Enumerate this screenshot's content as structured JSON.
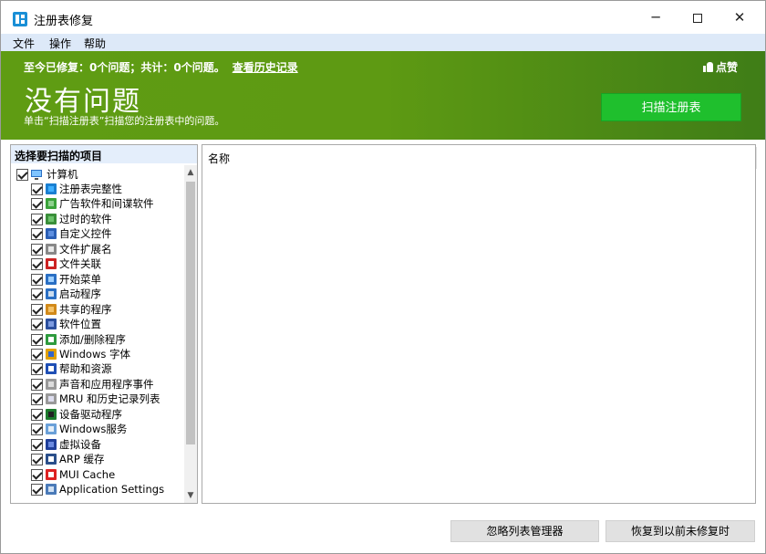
{
  "window": {
    "title": "注册表修复"
  },
  "menu": [
    "文件",
    "操作",
    "帮助"
  ],
  "banner": {
    "stats": "至今已修复：0个问题；共计：0个问题。",
    "history_link": "查看历史记录",
    "like": "点赞",
    "headline": "没有问题",
    "hint": "单击“扫描注册表”扫描您的注册表中的问题。",
    "scan_button": "扫描注册表"
  },
  "left_panel": {
    "header": "选择要扫描的项目",
    "root": "计算机",
    "items": [
      {
        "label": "注册表完整性",
        "icon": "registry-icon"
      },
      {
        "label": "广告软件和间谍软件",
        "icon": "adware-icon"
      },
      {
        "label": "过时的软件",
        "icon": "trash-icon"
      },
      {
        "label": "自定义控件",
        "icon": "controls-icon"
      },
      {
        "label": "文件扩展名",
        "icon": "file-extension-icon"
      },
      {
        "label": "文件关联",
        "icon": "file-association-icon"
      },
      {
        "label": "开始菜单",
        "icon": "start-menu-icon"
      },
      {
        "label": "启动程序",
        "icon": "startup-icon"
      },
      {
        "label": "共享的程序",
        "icon": "shared-program-icon"
      },
      {
        "label": "软件位置",
        "icon": "software-location-icon"
      },
      {
        "label": "添加/删除程序",
        "icon": "add-remove-icon"
      },
      {
        "label": "Windows 字体",
        "icon": "font-icon"
      },
      {
        "label": "帮助和资源",
        "icon": "help-icon"
      },
      {
        "label": "声音和应用程序事件",
        "icon": "sound-icon"
      },
      {
        "label": "MRU 和历史记录列表",
        "icon": "history-icon"
      },
      {
        "label": "设备驱动程序",
        "icon": "driver-icon"
      },
      {
        "label": "Windows服务",
        "icon": "service-icon"
      },
      {
        "label": "虚拟设备",
        "icon": "virtual-device-icon"
      },
      {
        "label": "ARP 缓存",
        "icon": "arp-icon"
      },
      {
        "label": "MUI Cache",
        "icon": "mui-cache-icon"
      },
      {
        "label": "Application Settings",
        "icon": "app-settings-icon"
      }
    ]
  },
  "right_panel": {
    "column_name": "名称"
  },
  "buttons": {
    "ignore_list": "忽略列表管理器",
    "restore": "恢复到以前未修复时"
  },
  "colors": {
    "banner_green": "#5f9c13",
    "scan_button": "#1fbf2d",
    "menubar": "#dde9f8"
  }
}
